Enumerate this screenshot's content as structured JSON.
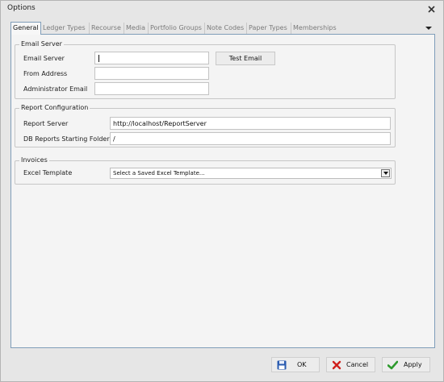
{
  "window": {
    "title": "Options"
  },
  "tabs": [
    {
      "label": "General",
      "active": true
    },
    {
      "label": "Ledger Types",
      "active": false
    },
    {
      "label": "Recourse",
      "active": false
    },
    {
      "label": "Media",
      "active": false
    },
    {
      "label": "Portfolio Groups",
      "active": false
    },
    {
      "label": "Note Codes",
      "active": false
    },
    {
      "label": "Paper Types",
      "active": false
    },
    {
      "label": "Memberships",
      "active": false
    }
  ],
  "email_server": {
    "group_title": "Email Server",
    "email_server_label": "Email Server",
    "email_server_value": "",
    "from_address_label": "From Address",
    "from_address_value": "",
    "admin_email_label": "Administrator Email",
    "admin_email_value": "",
    "test_email_button": "Test Email"
  },
  "report_configuration": {
    "group_title": "Report Configuration",
    "report_server_label": "Report Server",
    "report_server_value": "http://localhost/ReportServer",
    "db_reports_folder_label": "DB Reports Starting Folder",
    "db_reports_folder_value": "/"
  },
  "invoices": {
    "group_title": "Invoices",
    "excel_template_label": "Excel Template",
    "excel_template_selected": "Select a Saved Excel Template..."
  },
  "footer": {
    "ok_label": "OK",
    "cancel_label": "Cancel",
    "apply_label": "Apply"
  },
  "icons": {
    "ok": "floppy-disk-icon",
    "cancel": "red-x-icon",
    "apply": "green-checkmark-icon"
  },
  "colors": {
    "ok_icon": "#2a5bb0",
    "cancel_icon": "#d0201c",
    "apply_icon": "#2e9a2e",
    "panel_border": "#7f9db9"
  }
}
